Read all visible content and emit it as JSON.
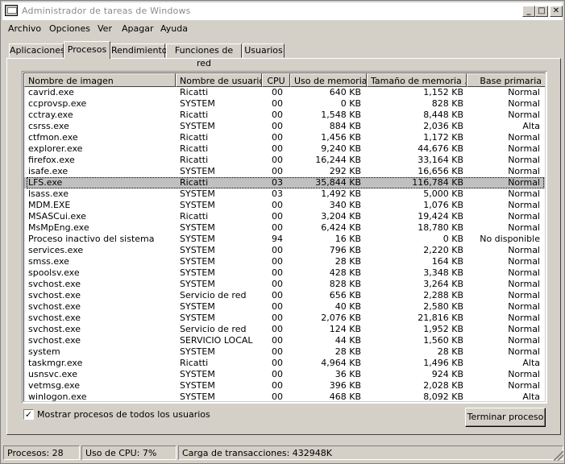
{
  "window": {
    "title": "Administrador de tareas de Windows"
  },
  "menu": [
    "Archivo",
    "Opciones",
    "Ver",
    "Apagar",
    "Ayuda"
  ],
  "tabs": [
    "Aplicaciones",
    "Procesos",
    "Rendimiento",
    "Funciones de red",
    "Usuarios"
  ],
  "active_tab": "Procesos",
  "columns": [
    "Nombre de imagen",
    "Nombre de usuario",
    "CPU",
    "Uso de memoria",
    "Tamaño de memoria ...",
    "Base primaria"
  ],
  "processes": [
    [
      "cavrid.exe",
      "Ricatti",
      "00",
      "640 KB",
      "1,152 KB",
      "Normal"
    ],
    [
      "ccprovsp.exe",
      "SYSTEM",
      "00",
      "0 KB",
      "828 KB",
      "Normal"
    ],
    [
      "cctray.exe",
      "Ricatti",
      "00",
      "1,548 KB",
      "8,448 KB",
      "Normal"
    ],
    [
      "csrss.exe",
      "SYSTEM",
      "00",
      "884 KB",
      "2,036 KB",
      "Alta"
    ],
    [
      "ctfmon.exe",
      "Ricatti",
      "00",
      "1,456 KB",
      "1,172 KB",
      "Normal"
    ],
    [
      "explorer.exe",
      "Ricatti",
      "00",
      "9,240 KB",
      "44,676 KB",
      "Normal"
    ],
    [
      "firefox.exe",
      "Ricatti",
      "00",
      "16,244 KB",
      "33,164 KB",
      "Normal"
    ],
    [
      "isafe.exe",
      "SYSTEM",
      "00",
      "292 KB",
      "16,656 KB",
      "Normal"
    ],
    [
      "LFS.exe",
      "Ricatti",
      "03",
      "35,844 KB",
      "116,784 KB",
      "Normal"
    ],
    [
      "lsass.exe",
      "SYSTEM",
      "03",
      "1,492 KB",
      "5,000 KB",
      "Normal"
    ],
    [
      "MDM.EXE",
      "SYSTEM",
      "00",
      "340 KB",
      "1,076 KB",
      "Normal"
    ],
    [
      "MSASCui.exe",
      "Ricatti",
      "00",
      "3,204 KB",
      "19,424 KB",
      "Normal"
    ],
    [
      "MsMpEng.exe",
      "SYSTEM",
      "00",
      "6,424 KB",
      "18,780 KB",
      "Normal"
    ],
    [
      "Proceso inactivo del sistema",
      "SYSTEM",
      "94",
      "16 KB",
      "0 KB",
      "No disponible"
    ],
    [
      "services.exe",
      "SYSTEM",
      "00",
      "796 KB",
      "2,220 KB",
      "Normal"
    ],
    [
      "smss.exe",
      "SYSTEM",
      "00",
      "28 KB",
      "164 KB",
      "Normal"
    ],
    [
      "spoolsv.exe",
      "SYSTEM",
      "00",
      "428 KB",
      "3,348 KB",
      "Normal"
    ],
    [
      "svchost.exe",
      "SYSTEM",
      "00",
      "828 KB",
      "3,264 KB",
      "Normal"
    ],
    [
      "svchost.exe",
      "Servicio de red",
      "00",
      "656 KB",
      "2,288 KB",
      "Normal"
    ],
    [
      "svchost.exe",
      "SYSTEM",
      "00",
      "40 KB",
      "2,580 KB",
      "Normal"
    ],
    [
      "svchost.exe",
      "SYSTEM",
      "00",
      "2,076 KB",
      "21,816 KB",
      "Normal"
    ],
    [
      "svchost.exe",
      "Servicio de red",
      "00",
      "124 KB",
      "1,952 KB",
      "Normal"
    ],
    [
      "svchost.exe",
      "SERVICIO LOCAL",
      "00",
      "44 KB",
      "1,560 KB",
      "Normal"
    ],
    [
      "system",
      "SYSTEM",
      "00",
      "28 KB",
      "28 KB",
      "Normal"
    ],
    [
      "taskmgr.exe",
      "Ricatti",
      "00",
      "4,964 KB",
      "1,496 KB",
      "Alta"
    ],
    [
      "usnsvc.exe",
      "SYSTEM",
      "00",
      "36 KB",
      "924 KB",
      "Normal"
    ],
    [
      "vetmsg.exe",
      "SYSTEM",
      "00",
      "396 KB",
      "2,028 KB",
      "Normal"
    ],
    [
      "winlogon.exe",
      "SYSTEM",
      "00",
      "468 KB",
      "8,092 KB",
      "Alta"
    ]
  ],
  "selected_process": "LFS.exe",
  "show_all_users": {
    "label": "Mostrar procesos de todos los usuarios",
    "checked": true
  },
  "end_process_label": "Terminar proceso",
  "status": {
    "processes": "Procesos: 28",
    "cpu": "Uso de CPU: 7%",
    "commit": "Carga de transacciones: 432948K"
  },
  "colors": {
    "face": "#d4d0c8",
    "selected_row": "#c0c0c0",
    "title_text": "#8a8a8a"
  }
}
